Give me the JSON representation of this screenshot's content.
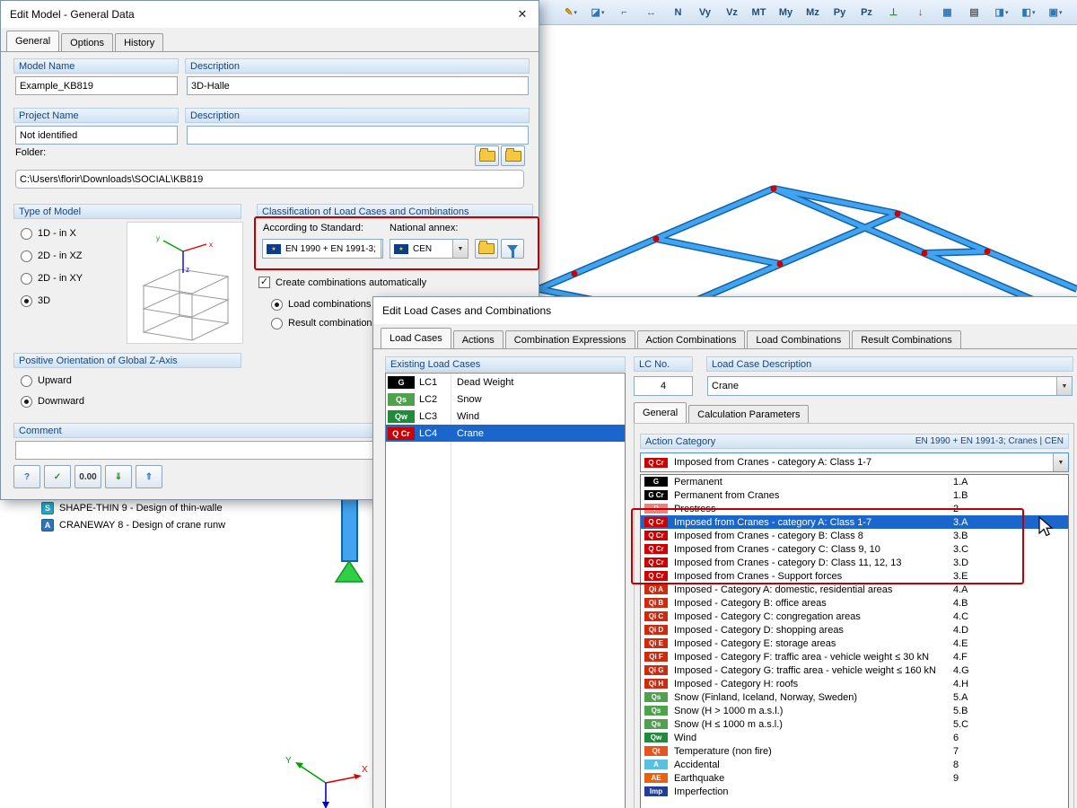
{
  "colors": {
    "selection": "#1a66cc",
    "annotation": "#c00000",
    "header_text": "#17447e",
    "member_blue": "#42a4f0"
  },
  "toolbar": {
    "items": [
      {
        "name": "edit-tool-dropdown",
        "glyph": "✎",
        "color": "#b8860b",
        "arrow": "▾"
      },
      {
        "name": "render-mode-dropdown",
        "glyph": "◪",
        "color": "#2e75b6",
        "arrow": "▾"
      },
      {
        "name": "guide-object-button",
        "glyph": "⌐",
        "color": "#606060",
        "arrow": ""
      },
      {
        "name": "dimension-button",
        "glyph": "↔",
        "color": "#606060",
        "arrow": ""
      },
      {
        "name": "force-n-button",
        "glyph": "N",
        "color": "#1f4e79",
        "arrow": ""
      },
      {
        "name": "force-vy-button",
        "glyph": "Vy",
        "color": "#1f4e79",
        "arrow": ""
      },
      {
        "name": "force-vz-button",
        "glyph": "Vz",
        "color": "#1f4e79",
        "arrow": ""
      },
      {
        "name": "force-mt-button",
        "glyph": "MT",
        "color": "#1f4e79",
        "arrow": ""
      },
      {
        "name": "force-my-button",
        "glyph": "My",
        "color": "#1f4e79",
        "arrow": ""
      },
      {
        "name": "force-mz-button",
        "glyph": "Mz",
        "color": "#1f4e79",
        "arrow": ""
      },
      {
        "name": "force-py-button",
        "glyph": "Py",
        "color": "#1f4e79",
        "arrow": ""
      },
      {
        "name": "force-pz-button",
        "glyph": "Pz",
        "color": "#1f4e79",
        "arrow": ""
      },
      {
        "name": "supports-button",
        "glyph": "⊥",
        "color": "#2e8b2e",
        "arrow": ""
      },
      {
        "name": "loads-button",
        "glyph": "↓",
        "color": "#cc2020",
        "arrow": ""
      },
      {
        "name": "tables-button",
        "glyph": "▦",
        "color": "#2e75b6",
        "arrow": ""
      },
      {
        "name": "printout-report-button",
        "glyph": "▤",
        "color": "#606060",
        "arrow": ""
      },
      {
        "name": "display-panel-dropdown",
        "glyph": "◨",
        "color": "#2e75b6",
        "arrow": "▾"
      },
      {
        "name": "display-panel2-dropdown",
        "glyph": "◧",
        "color": "#2e75b6",
        "arrow": "▾"
      },
      {
        "name": "monitor-dropdown",
        "glyph": "▣",
        "color": "#2e75b6",
        "arrow": "▾"
      }
    ]
  },
  "navigator": {
    "items": [
      {
        "name": "module-shape-thin",
        "icon_text": "S",
        "icon_bg": "#29a8c9",
        "label": "SHAPE-THIN 9 - Design of thin-walle"
      },
      {
        "name": "module-craneway",
        "icon_text": "A",
        "icon_bg": "#2e75b6",
        "label": "CRANEWAY 8 - Design of crane runw"
      }
    ]
  },
  "axes": {
    "x_label": "X",
    "y_label": "Y"
  },
  "edit_model": {
    "title": "Edit Model - General Data",
    "close_glyph": "✕",
    "tabs": [
      {
        "label": "General",
        "active": true
      },
      {
        "label": "Options"
      },
      {
        "label": "History"
      }
    ],
    "model_name_label": "Model Name",
    "description_label": "Description",
    "model_name": "Example_KB819",
    "model_description": "3D-Halle",
    "project_name_label": "Project Name",
    "project_description_label": "Description",
    "project_name": "Not identified",
    "project_description": "",
    "folder_label": "Folder:",
    "folder_path": "C:\\Users\\florir\\Downloads\\SOCIAL\\KB819",
    "type_of_model_label": "Type of Model",
    "type_options": [
      {
        "label": "1D - in X"
      },
      {
        "label": "2D - in XZ"
      },
      {
        "label": "2D - in XY"
      },
      {
        "label": "3D",
        "selected": true
      }
    ],
    "classification_label": "Classification of Load Cases and Combinations",
    "standard_label": "According to Standard:",
    "standard_value": "EN 1990 + EN 1991-3;",
    "annex_label": "National annex:",
    "annex_value": "CEN",
    "create_combinations_label": "Create combinations automatically",
    "create_combinations_checked": true,
    "combination_options": [
      {
        "label": "Load combinations",
        "selected": true
      },
      {
        "label": "Result combinations"
      }
    ],
    "z_axis_label": "Positive Orientation of Global Z-Axis",
    "z_options": [
      {
        "label": "Upward"
      },
      {
        "label": "Downward",
        "selected": true
      }
    ],
    "comment_label": "Comment",
    "comment_value": "",
    "buttons": [
      {
        "name": "help-button",
        "glyph": "?",
        "color": "#2e75b6"
      },
      {
        "name": "check-settings-button",
        "glyph": "✓",
        "color": "#2e8b2e"
      },
      {
        "name": "decimal-places-button",
        "glyph": "0.00",
        "color": "#333333"
      },
      {
        "name": "import-settings-button",
        "glyph": "⇓",
        "color": "#2e8b2e"
      },
      {
        "name": "export-settings-button",
        "glyph": "⇑",
        "color": "#2e75b6"
      }
    ]
  },
  "load_cases": {
    "title": "Edit Load Cases and Combinations",
    "tabs": [
      {
        "label": "Load Cases",
        "active": true
      },
      {
        "label": "Actions"
      },
      {
        "label": "Combination Expressions"
      },
      {
        "label": "Action Combinations"
      },
      {
        "label": "Load Combinations"
      },
      {
        "label": "Result Combinations"
      }
    ],
    "existing_label": "Existing Load Cases",
    "cases": [
      {
        "badge": "G",
        "badge_color": "#000000",
        "id": "LC1",
        "desc": "Dead Weight"
      },
      {
        "badge": "Qs",
        "badge_color": "#4ea24e",
        "id": "LC2",
        "desc": "Snow"
      },
      {
        "badge": "Qw",
        "badge_color": "#228b3b",
        "id": "LC3",
        "desc": "Wind"
      },
      {
        "badge": "Q Cr",
        "badge_color": "#cc0000",
        "id": "LC4",
        "desc": "Crane",
        "selected": true
      }
    ],
    "lc_no_label": "LC No.",
    "lc_no": "4",
    "desc_label": "Load Case Description",
    "desc_value": "Crane",
    "sub_tabs": [
      {
        "label": "General",
        "active": true
      },
      {
        "label": "Calculation Parameters"
      }
    ],
    "action_category_label": "Action Category",
    "action_category_standard": "EN 1990 + EN 1991-3; Cranes | CEN",
    "selected_category": {
      "badge": "Q Cr",
      "badge_color": "#cc0000",
      "label": "Imposed from Cranes - category A: Class 1-7"
    },
    "categories": [
      {
        "badge": "G",
        "badge_color": "#000000",
        "label": "Permanent",
        "code": "1.A"
      },
      {
        "badge": "G Cr",
        "badge_color": "#000000",
        "label": "Permanent from Cranes",
        "code": "1.B"
      },
      {
        "badge": "P",
        "badge_color": "#ef8080",
        "label": "Prestress",
        "code": "2"
      },
      {
        "badge": "Q Cr",
        "badge_color": "#cc0000",
        "label": "Imposed from Cranes - category A: Class 1-7",
        "code": "3.A",
        "selected": true
      },
      {
        "badge": "Q Cr",
        "badge_color": "#cc0000",
        "label": "Imposed from Cranes - category B: Class 8",
        "code": "3.B"
      },
      {
        "badge": "Q Cr",
        "badge_color": "#cc0000",
        "label": "Imposed from Cranes - category C: Class 9, 10",
        "code": "3.C"
      },
      {
        "badge": "Q Cr",
        "badge_color": "#cc0000",
        "label": "Imposed from Cranes - category D: Class 11, 12, 13",
        "code": "3.D"
      },
      {
        "badge": "Q Cr",
        "badge_color": "#cc0000",
        "label": "Imposed from Cranes - Support forces",
        "code": "3.E"
      },
      {
        "badge": "Qi A",
        "badge_color": "#cf2a0e",
        "label": "Imposed - Category A: domestic, residential areas",
        "code": "4.A"
      },
      {
        "badge": "Qi B",
        "badge_color": "#cf2a0e",
        "label": "Imposed - Category B: office areas",
        "code": "4.B"
      },
      {
        "badge": "Qi C",
        "badge_color": "#cf2a0e",
        "label": "Imposed - Category C: congregation areas",
        "code": "4.C"
      },
      {
        "badge": "Qi D",
        "badge_color": "#cf2a0e",
        "label": "Imposed - Category D: shopping areas",
        "code": "4.D"
      },
      {
        "badge": "Qi E",
        "badge_color": "#cf2a0e",
        "label": "Imposed - Category E: storage areas",
        "code": "4.E"
      },
      {
        "badge": "Qi F",
        "badge_color": "#cf2a0e",
        "label": "Imposed - Category F: traffic area - vehicle weight ≤ 30 kN",
        "code": "4.F"
      },
      {
        "badge": "Qi G",
        "badge_color": "#cf2a0e",
        "label": "Imposed - Category G: traffic area - vehicle weight ≤ 160 kN",
        "code": "4.G"
      },
      {
        "badge": "Qi H",
        "badge_color": "#cf2a0e",
        "label": "Imposed - Category H: roofs",
        "code": "4.H"
      },
      {
        "badge": "Qs",
        "badge_color": "#4ea24e",
        "label": "Snow (Finland, Iceland, Norway, Sweden)",
        "code": "5.A"
      },
      {
        "badge": "Qs",
        "badge_color": "#4ea24e",
        "label": "Snow (H > 1000 m a.s.l.)",
        "code": "5.B"
      },
      {
        "badge": "Qs",
        "badge_color": "#4ea24e",
        "label": "Snow (H ≤ 1000 m a.s.l.)",
        "code": "5.C"
      },
      {
        "badge": "Qw",
        "badge_color": "#228b3b",
        "label": "Wind",
        "code": "6"
      },
      {
        "badge": "Qt",
        "badge_color": "#e8541e",
        "label": "Temperature (non fire)",
        "code": "7"
      },
      {
        "badge": "A",
        "badge_color": "#5bc0de",
        "label": "Accidental",
        "code": "8"
      },
      {
        "badge": "AE",
        "badge_color": "#e8610f",
        "label": "Earthquake",
        "code": "9"
      },
      {
        "badge": "Imp",
        "badge_color": "#1f3d99",
        "label": "Imperfection",
        "code": ""
      }
    ]
  }
}
